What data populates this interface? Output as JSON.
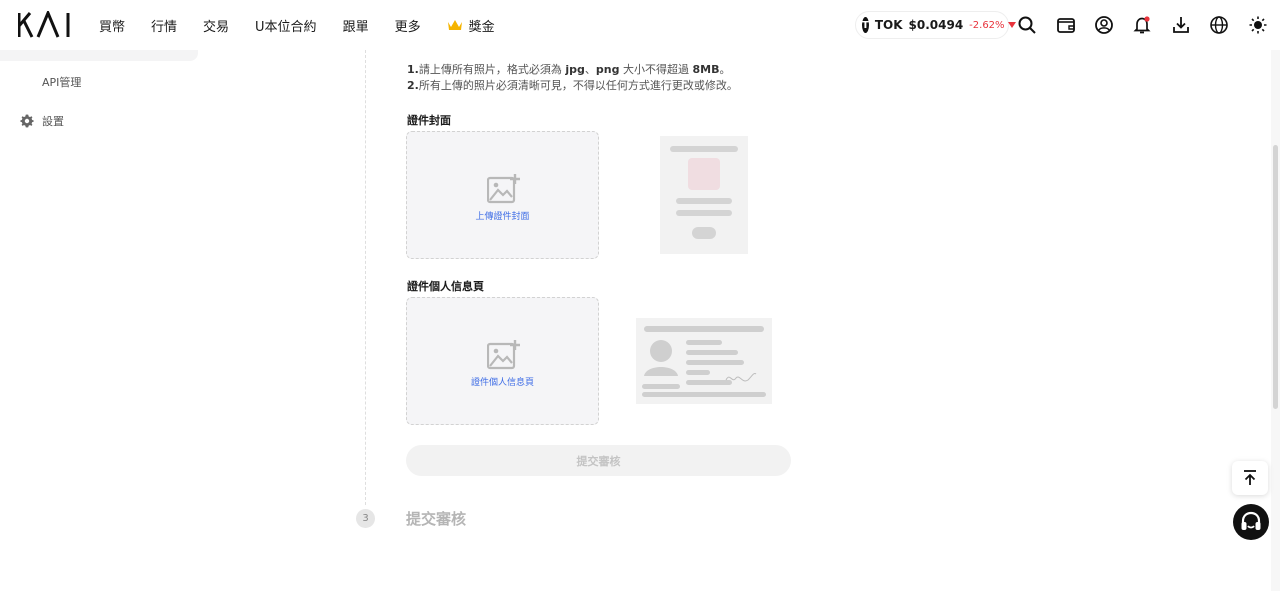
{
  "header": {
    "logo_text": "KAI",
    "nav": [
      "買幣",
      "行情",
      "交易",
      "U本位合約",
      "跟單",
      "更多"
    ],
    "rewards_label": "獎金",
    "ticker": {
      "symbol": "TOK",
      "icon_letter": "T",
      "price": "$0.0494",
      "change": "-2.62%"
    },
    "icons": [
      "search-icon",
      "wallet-icon",
      "user-icon",
      "bell-icon",
      "download-icon",
      "globe-icon",
      "theme-sun-icon"
    ]
  },
  "sidebar": {
    "items": [
      {
        "label": "API管理",
        "icon": ""
      },
      {
        "label": "設置",
        "icon": "gear-icon"
      }
    ]
  },
  "main": {
    "notes": [
      {
        "num": "1.",
        "parts": [
          "請上傳所有照片，格式必須為 ",
          "jpg",
          "、",
          "png",
          " 大小不得超過 ",
          "8MB",
          "。"
        ]
      },
      {
        "num": "2.",
        "text": "所有上傳的照片必須清晰可見，不得以任何方式進行更改或修改。"
      }
    ],
    "cover": {
      "label": "證件封面",
      "upload_text": "上傳證件封面"
    },
    "info_page": {
      "label": "證件個人信息頁",
      "upload_text": "證件個人信息頁"
    },
    "submit_label": "提交審核",
    "step": {
      "number": "3",
      "title": "提交審核"
    }
  },
  "colors": {
    "accent_blue": "#3d6ce6",
    "negative_red": "#e8333c",
    "muted_gray": "#b5b5b5"
  }
}
